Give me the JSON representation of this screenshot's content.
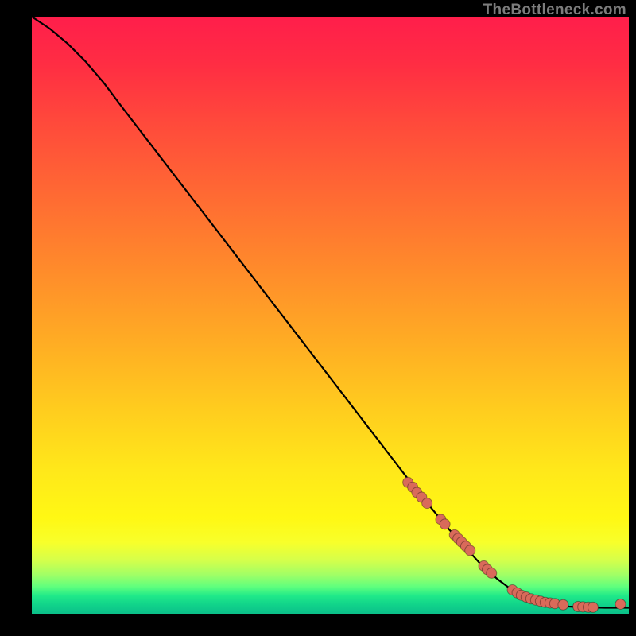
{
  "watermark": "TheBottleneck.com",
  "chart_data": {
    "type": "line",
    "title": "",
    "xlabel": "",
    "ylabel": "",
    "xlim": [
      0,
      100
    ],
    "ylim": [
      0,
      100
    ],
    "curve": {
      "name": "bottleneck-curve",
      "x": [
        0,
        3,
        6,
        9,
        12,
        15,
        20,
        25,
        30,
        35,
        40,
        45,
        50,
        55,
        60,
        65,
        70,
        75,
        78,
        80,
        82,
        84,
        86,
        88,
        90,
        92,
        94,
        96,
        98,
        100
      ],
      "y": [
        100,
        98,
        95.5,
        92.5,
        89,
        85,
        78.5,
        72,
        65.5,
        59,
        52.5,
        46,
        39.5,
        33,
        26.5,
        20,
        14,
        8.5,
        5.8,
        4.3,
        3.2,
        2.4,
        1.8,
        1.4,
        1.2,
        1.1,
        1.05,
        1.0,
        1.0,
        1.0
      ]
    },
    "series": [
      {
        "name": "highlight-points",
        "color": "#d96a5a",
        "x": [
          63,
          63.8,
          64.5,
          65.3,
          66.2,
          68.5,
          69.2,
          70.8,
          71.4,
          72.0,
          72.7,
          73.4,
          75.7,
          76.3,
          77.0,
          80.5,
          81.3,
          82.0,
          82.8,
          83.6,
          84.4,
          85.2,
          86.0,
          86.8,
          87.6,
          89.0,
          91.5,
          92.3,
          93.2,
          94.0,
          98.6
        ],
        "y": [
          22.0,
          21.2,
          20.3,
          19.5,
          18.5,
          15.8,
          15.0,
          13.2,
          12.6,
          12.0,
          11.3,
          10.6,
          8.0,
          7.4,
          6.8,
          4.0,
          3.5,
          3.1,
          2.8,
          2.5,
          2.3,
          2.1,
          1.9,
          1.8,
          1.7,
          1.5,
          1.2,
          1.15,
          1.1,
          1.08,
          1.6
        ]
      }
    ]
  }
}
